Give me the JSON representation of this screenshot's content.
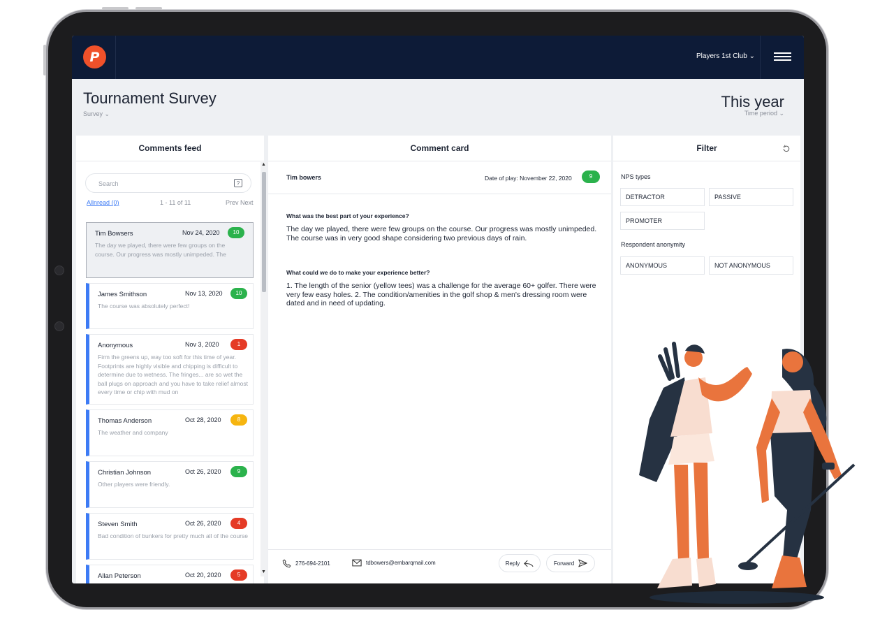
{
  "app": {
    "club": "Players 1st Club ⌄"
  },
  "header": {
    "survey_title": "Tournament Survey",
    "survey_sub": "Survey ⌄",
    "period_title": "This year",
    "period_sub": "Time period ⌄"
  },
  "feed": {
    "title": "Comments feed",
    "search_placeholder": "Search",
    "all_read": "Allnread (0)",
    "range": "1 - 11 of 11",
    "pager": "Prev Next",
    "items": [
      {
        "name": "Tim Bowsers",
        "date": "Nov 24, 2020",
        "score": "10",
        "text": "The day we played, there were few groups on the course. Our progress was mostly unimpeded. The"
      },
      {
        "name": "James Smithson",
        "date": "Nov 13, 2020",
        "score": "10",
        "text": "The course was absolutely perfect!"
      },
      {
        "name": "Anonymous",
        "date": "Nov 3, 2020",
        "score": "1",
        "text": "Firm the greens up, way too soft for this time of year. Footprints are highly visible and chipping is difficult to determine due to wetness. The fringes... are so wet the ball plugs on approach and you have to take relief almost every time or chip with mud on"
      },
      {
        "name": "Thomas Anderson",
        "date": "Oct 28, 2020",
        "score": "8",
        "text": "The weather and company"
      },
      {
        "name": "Christian Johnson",
        "date": "Oct 26, 2020",
        "score": "9",
        "text": "Other players were friendly."
      },
      {
        "name": "Steven Smith",
        "date": "Oct 26, 2020",
        "score": "4",
        "text": "Bad condition of bunkers for pretty much all of the course"
      },
      {
        "name": "Allan Peterson",
        "date": "Oct 20, 2020",
        "score": "5",
        "text": ""
      }
    ]
  },
  "comment_card": {
    "title": "Comment card",
    "name": "Tim bowers",
    "date_of_play": "Date of play: November 22, 2020",
    "score": "9",
    "q1": "What was the best part of your experience?",
    "a1": "The day we played, there were few groups on the course. Our progress was mostly unimpeded. The course was in very good shape considering two previous days of rain.",
    "q2": "What could we do to make your experience better?",
    "a2": "1. The length of the senior (yellow tees) was a challenge for the average 60+ golfer. There were very few easy holes. 2. The condition/amenities in the golf shop & men's dressing room were dated and in need of updating.",
    "phone": "276-694-2101",
    "email": "tdbowers@embarqmail.com",
    "reply_label": "Reply",
    "forward_label": "Forward"
  },
  "filter": {
    "title": "Filter",
    "nps_label": "NPS types",
    "nps_options": [
      "DETRACTOR",
      "PASSIVE",
      "PROMOTER"
    ],
    "anon_label": "Respondent anonymity",
    "anon_options": [
      "ANONYMOUS",
      "NOT ANONYMOUS"
    ]
  },
  "colors": {
    "navy": "#0d1b37",
    "brand_orange": "#f0512a",
    "promoter_green": "#2bb24c",
    "detractor_red": "#e53b26",
    "passive_yellow": "#f6b510",
    "unread_blue": "#3d7bf5"
  }
}
